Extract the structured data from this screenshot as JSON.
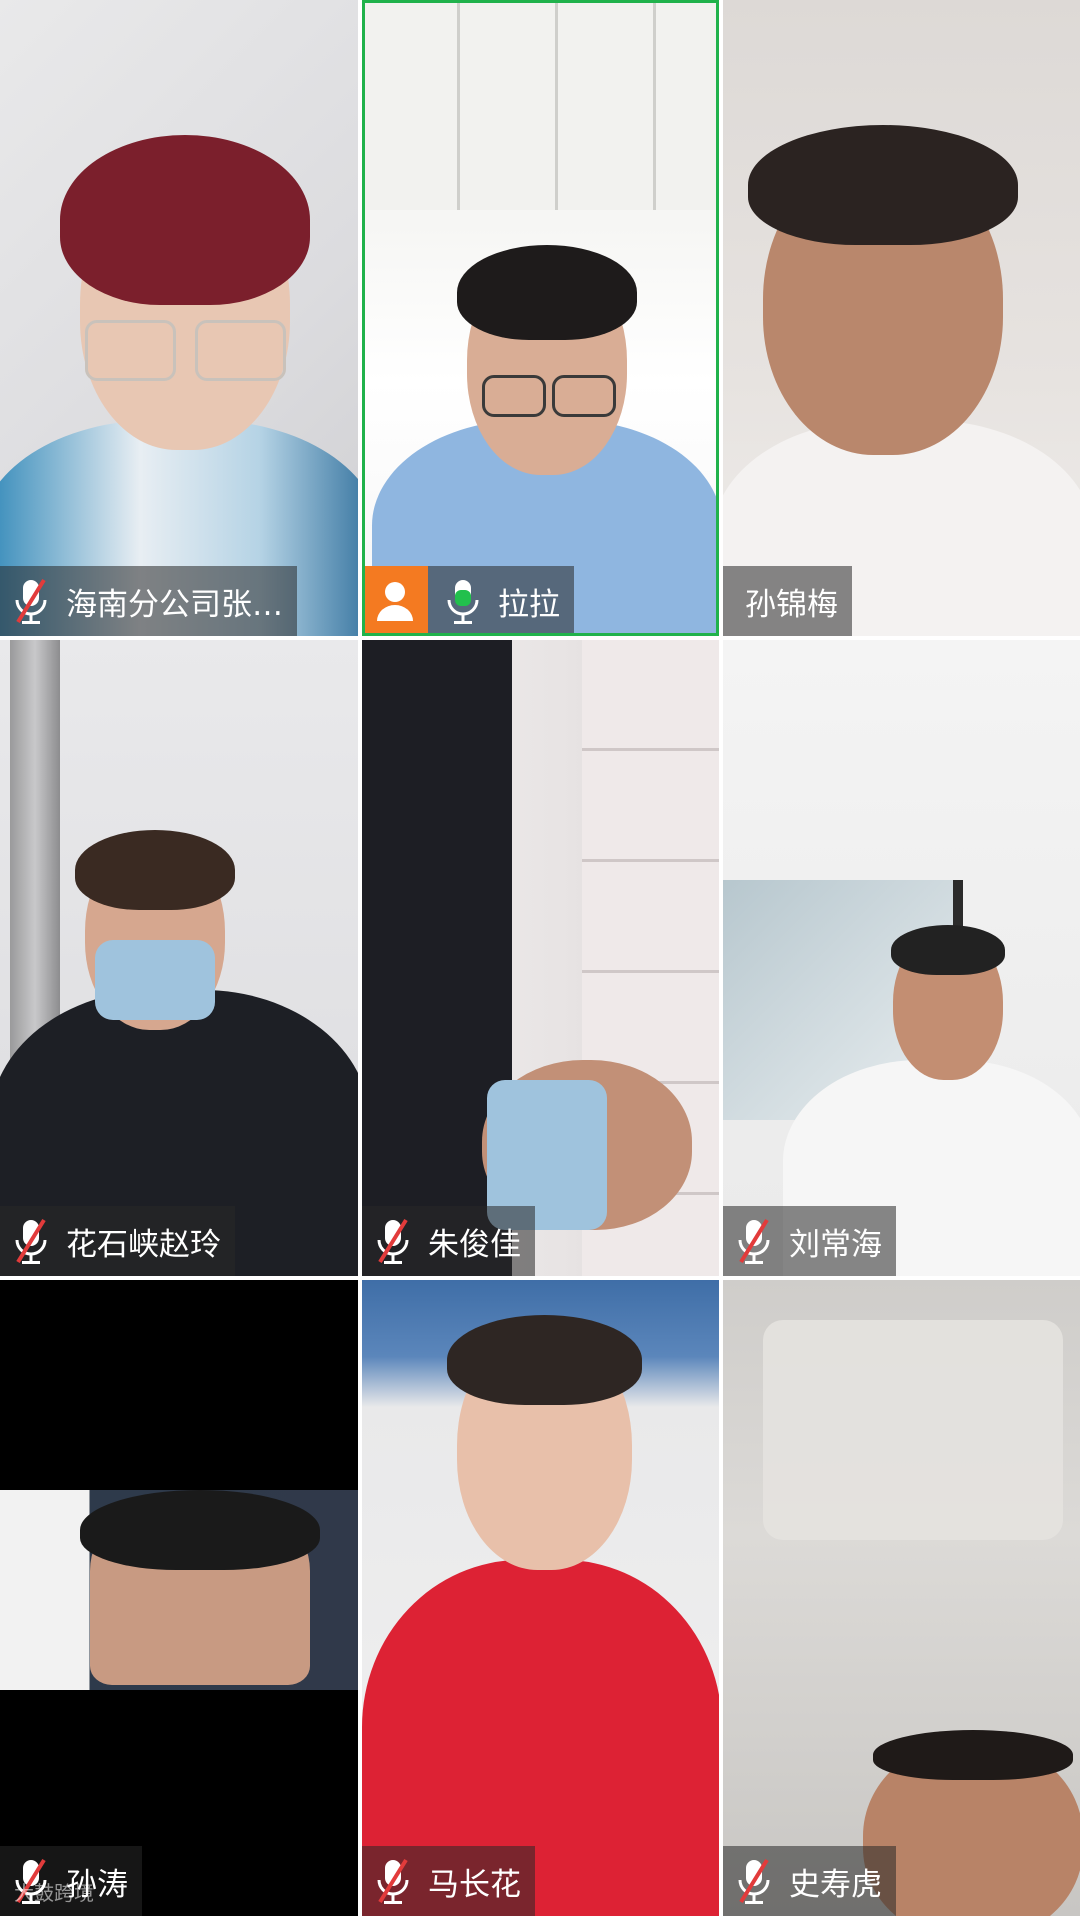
{
  "participants": [
    {
      "name": "海南分公司张…",
      "mic": "muted",
      "active": false,
      "avatar_badge": false
    },
    {
      "name": "拉拉",
      "mic": "speaking",
      "active": true,
      "avatar_badge": true
    },
    {
      "name": "孙锦梅",
      "mic": "none",
      "active": false,
      "avatar_badge": false
    },
    {
      "name": "花石峡赵玲",
      "mic": "muted",
      "active": false,
      "avatar_badge": false
    },
    {
      "name": "朱俊佳",
      "mic": "muted",
      "active": false,
      "avatar_badge": false
    },
    {
      "name": "刘常海",
      "mic": "muted",
      "active": false,
      "avatar_badge": false
    },
    {
      "name": "孙涛",
      "mic": "muted",
      "active": false,
      "avatar_badge": false
    },
    {
      "name": "马长花",
      "mic": "muted",
      "active": false,
      "avatar_badge": false
    },
    {
      "name": "史寿虎",
      "mic": "muted",
      "active": false,
      "avatar_badge": false
    }
  ],
  "colors": {
    "active_border": "#20b24b",
    "speaking_mic": "#22c04d",
    "muted_slash": "#e23b3b",
    "avatar_badge": "#f47a21"
  },
  "watermark": "大鼓跨境"
}
